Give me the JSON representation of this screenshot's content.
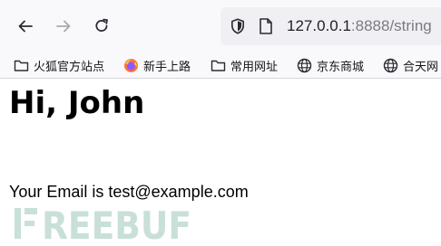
{
  "browser": {
    "nav": {
      "back_icon": "arrow-left-icon",
      "forward_icon": "arrow-right-icon",
      "reload_icon": "reload-icon"
    },
    "address": {
      "host": "127.0.0.1",
      "rest": ":8888/string",
      "shield_icon": "shield-icon",
      "page_icon": "page-icon"
    },
    "bookmarks": [
      {
        "label": "火狐官方站点",
        "icon": "folder-icon"
      },
      {
        "label": "新手上路",
        "icon": "firefox-icon"
      },
      {
        "label": "常用网址",
        "icon": "folder-icon"
      },
      {
        "label": "京东商城",
        "icon": "globe-icon"
      },
      {
        "label": "合天网",
        "icon": "globe-icon"
      }
    ]
  },
  "page": {
    "greeting": "Hi, John",
    "email_line": "Your Email is test@example.com"
  },
  "watermark": {
    "text": "FREEBUF"
  },
  "colors": {
    "toolbar_bg": "#f9f9fb",
    "urlbar_bg": "#f0f0f4",
    "watermark": "#c8e0d8"
  }
}
